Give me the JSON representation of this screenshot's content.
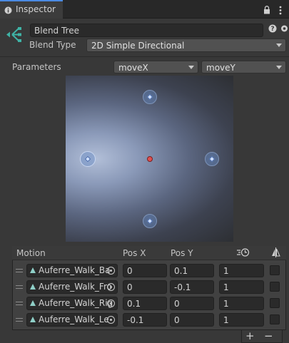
{
  "tab": {
    "icon": "info-icon",
    "title": "Inspector"
  },
  "toolbar": {
    "lock_icon": "lock-icon",
    "menu_icon": "kebab-menu-icon"
  },
  "header": {
    "icon": "blend-tree-icon",
    "name": "Blend Tree",
    "help_icon": "help-icon",
    "settings_icon": "settings-icon",
    "blend_type_label": "Blend Type",
    "blend_type_value": "2D Simple Directional"
  },
  "parameters": {
    "label": "Parameters",
    "x_param": "moveX",
    "y_param": "moveY"
  },
  "blend_graph": {
    "motions": [
      {
        "name": "Auferre_Walk_Back",
        "x": 0,
        "y": 0.1
      },
      {
        "name": "Auferre_Walk_Front",
        "x": 0,
        "y": -0.1
      },
      {
        "name": "Auferre_Walk_Right",
        "x": 0.1,
        "y": 0
      },
      {
        "name": "Auferre_Walk_Left",
        "x": -0.1,
        "y": 0
      }
    ],
    "selected_index": 3,
    "center_point": {
      "x": 0,
      "y": 0
    }
  },
  "motion_list": {
    "headers": {
      "motion": "Motion",
      "pos_x": "Pos X",
      "pos_y": "Pos Y",
      "speed_icon": "time-scale-icon",
      "mirror_icon": "mirror-icon"
    },
    "rows": [
      {
        "motion": "Auferre_Walk_Ba",
        "pos_x": "0",
        "pos_y": "0.1",
        "speed": "1"
      },
      {
        "motion": "Auferre_Walk_Fro",
        "pos_x": "0",
        "pos_y": "-0.1",
        "speed": "1"
      },
      {
        "motion": "Auferre_Walk_Rig",
        "pos_x": "0.1",
        "pos_y": "0",
        "speed": "1"
      },
      {
        "motion": "Auferre_Walk_Le",
        "pos_x": "-0.1",
        "pos_y": "0",
        "speed": "1"
      }
    ],
    "add_label": "+",
    "remove_label": "−"
  }
}
